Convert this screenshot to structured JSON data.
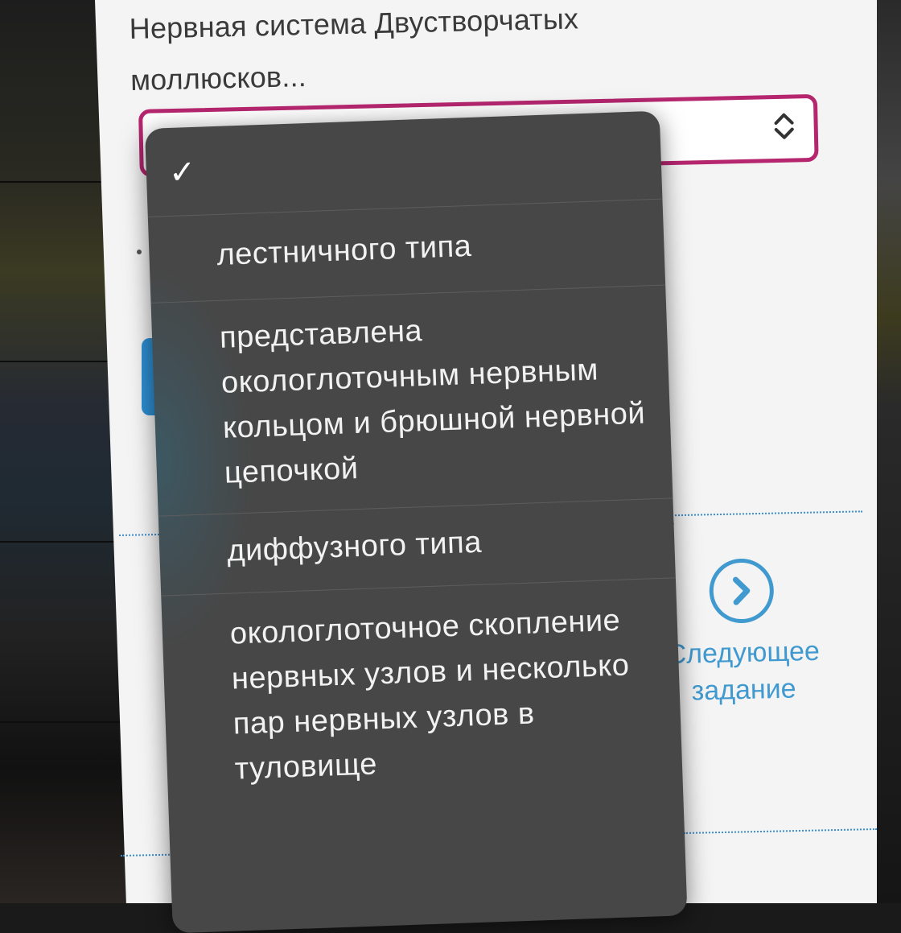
{
  "question": {
    "text": "Нервная система Двустворчатых моллюсков..."
  },
  "select": {
    "selected_value": "",
    "arrows_icon": "chevron-up-down-icon",
    "border_color": "#b5266f"
  },
  "dropdown": {
    "options": [
      {
        "label": "",
        "selected": true
      },
      {
        "label": "лестничного типа"
      },
      {
        "label": "представлена окологлоточным нервным кольцом и брюшной нервной цепочкой"
      },
      {
        "label": "диффузного типа"
      },
      {
        "label": "окологлоточное скопление нервных узлов и несколько пар нервных узлов в туловище"
      }
    ],
    "check_glyph": "✓"
  },
  "next_task": {
    "label": "Следующее задание",
    "icon": "chevron-right-circle-icon",
    "color": "#4099cf"
  }
}
